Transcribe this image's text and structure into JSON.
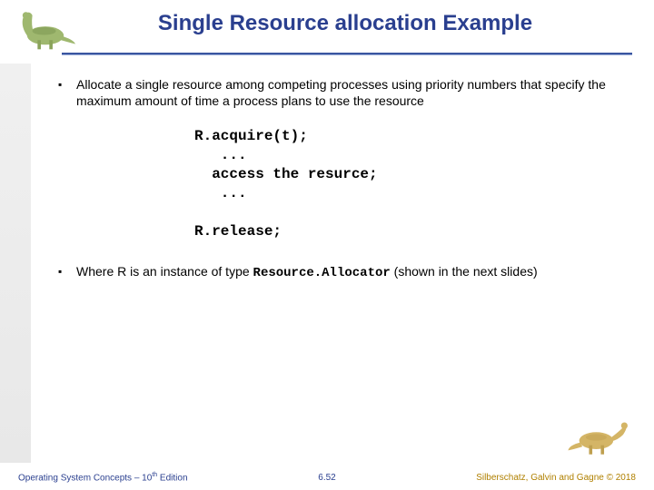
{
  "title": "Single Resource allocation Example",
  "bullets": [
    {
      "text": "Allocate a single resource among competing processes using priority numbers that specify the maximum amount of time a process plans to use the resource"
    },
    {
      "pre": "Where R is an instance of type ",
      "mono": "Resource.Allocator",
      "post": " (shown in the next slides)"
    }
  ],
  "code": "R.acquire(t);\n   ...\n  access the resurce;\n   ...\n\nR.release;",
  "footer": {
    "left_pre": "Operating System Concepts – 10",
    "left_sup": "th",
    "left_post": " Edition",
    "center": "6.52",
    "right": "Silberschatz, Galvin and Gagne © 2018"
  },
  "icons": {
    "top_dino": "dinosaur-icon",
    "bottom_dino": "dinosaur-icon"
  }
}
